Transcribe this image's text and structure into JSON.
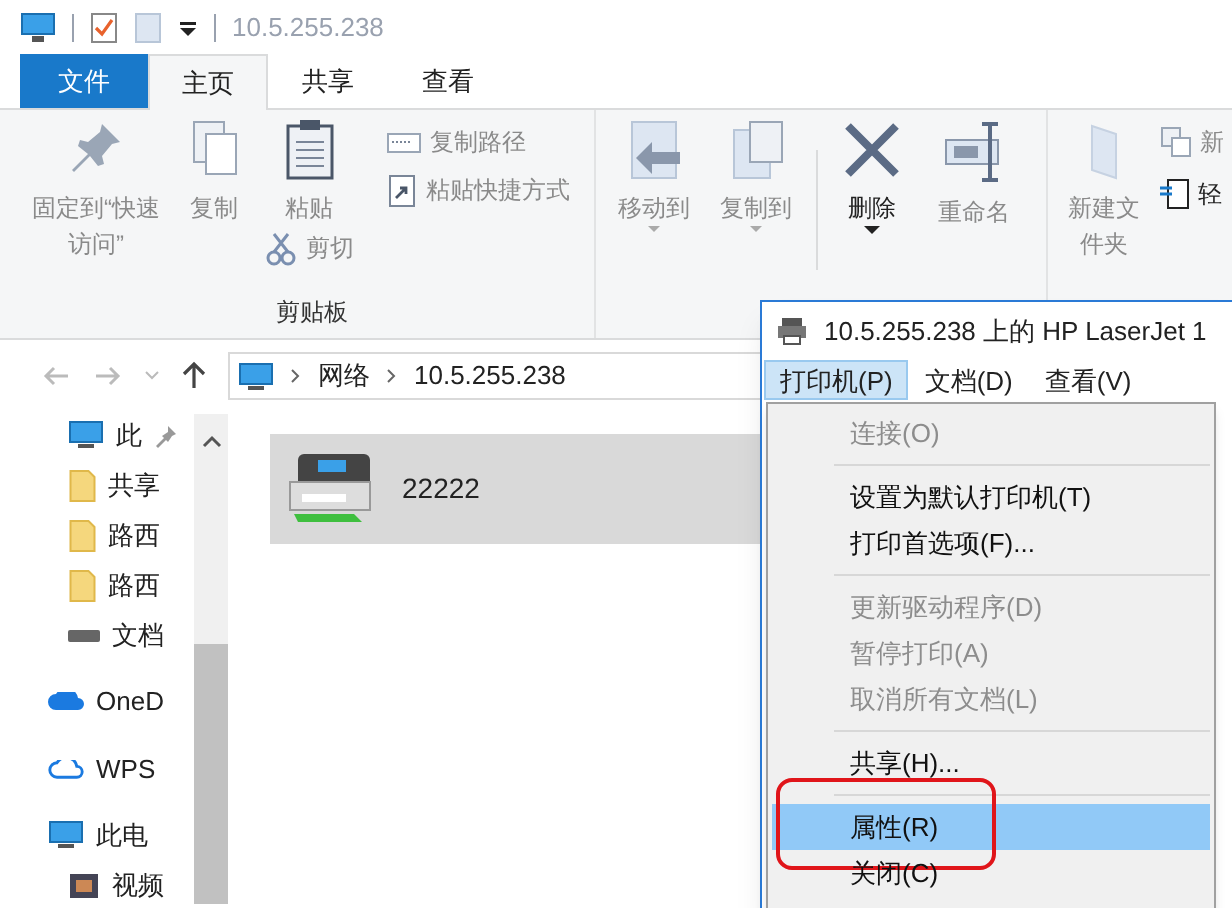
{
  "title_bar": {
    "title": "10.5.255.238"
  },
  "ribbon_tabs": [
    {
      "label": "文件",
      "kind": "file",
      "selected": false
    },
    {
      "label": "主页",
      "kind": "tab",
      "selected": true
    },
    {
      "label": "共享",
      "kind": "tab",
      "selected": false
    },
    {
      "label": "查看",
      "kind": "tab",
      "selected": false
    }
  ],
  "ribbon": {
    "clipboard_label": "剪贴板",
    "buttons": [
      {
        "label": "固定到“快速访问”",
        "disabled": true
      },
      {
        "label": "复制",
        "disabled": true
      },
      {
        "label": "粘贴",
        "disabled": true
      },
      {
        "label": "剪切",
        "disabled": true
      },
      {
        "label": "复制路径",
        "disabled": true
      },
      {
        "label": "粘贴快捷方式",
        "disabled": true
      },
      {
        "label": "移动到",
        "disabled": true
      },
      {
        "label": "复制到",
        "disabled": true
      },
      {
        "label": "删除",
        "disabled": false
      },
      {
        "label": "重命名",
        "disabled": true
      },
      {
        "label": "新建文件夹",
        "disabled": true
      },
      {
        "label": "新",
        "disabled": true
      },
      {
        "label": "轻",
        "disabled": false
      }
    ]
  },
  "address_bar": {
    "path": [
      "网络",
      "10.5.255.238"
    ]
  },
  "sidebar": {
    "items": [
      {
        "label": "此"
      },
      {
        "label": "共享"
      },
      {
        "label": "路西"
      },
      {
        "label": "路西"
      },
      {
        "label": "文档"
      },
      {
        "label": "OneD"
      },
      {
        "label": "WPS"
      },
      {
        "label": "此电"
      },
      {
        "label": "视频"
      }
    ]
  },
  "content": {
    "items": [
      {
        "label": "22222",
        "selected": true
      }
    ]
  },
  "printer_window": {
    "title": "10.5.255.238 上的 HP LaserJet 1",
    "menu_bar": [
      {
        "label": "打印机(P)",
        "selected": true
      },
      {
        "label": "文档(D)",
        "selected": false
      },
      {
        "label": "查看(V)",
        "selected": false
      }
    ],
    "menu": [
      {
        "kind": "item",
        "label": "连接(O)",
        "disabled": true,
        "selected": false,
        "circled": false
      },
      {
        "kind": "separator"
      },
      {
        "kind": "item",
        "label": "设置为默认打印机(T)",
        "disabled": false,
        "selected": false,
        "circled": false
      },
      {
        "kind": "item",
        "label": "打印首选项(F)...",
        "disabled": false,
        "selected": false,
        "circled": false
      },
      {
        "kind": "separator"
      },
      {
        "kind": "item",
        "label": "更新驱动程序(D)",
        "disabled": true,
        "selected": false,
        "circled": false
      },
      {
        "kind": "item",
        "label": "暂停打印(A)",
        "disabled": true,
        "selected": false,
        "circled": false
      },
      {
        "kind": "item",
        "label": "取消所有文档(L)",
        "disabled": true,
        "selected": false,
        "circled": false
      },
      {
        "kind": "separator"
      },
      {
        "kind": "item",
        "label": "共享(H)...",
        "disabled": false,
        "selected": false,
        "circled": false
      },
      {
        "kind": "separator"
      },
      {
        "kind": "item",
        "label": "属性(R)",
        "disabled": false,
        "selected": true,
        "circled": true
      },
      {
        "kind": "item",
        "label": "关闭(C)",
        "disabled": false,
        "selected": false,
        "circled": false
      }
    ]
  }
}
